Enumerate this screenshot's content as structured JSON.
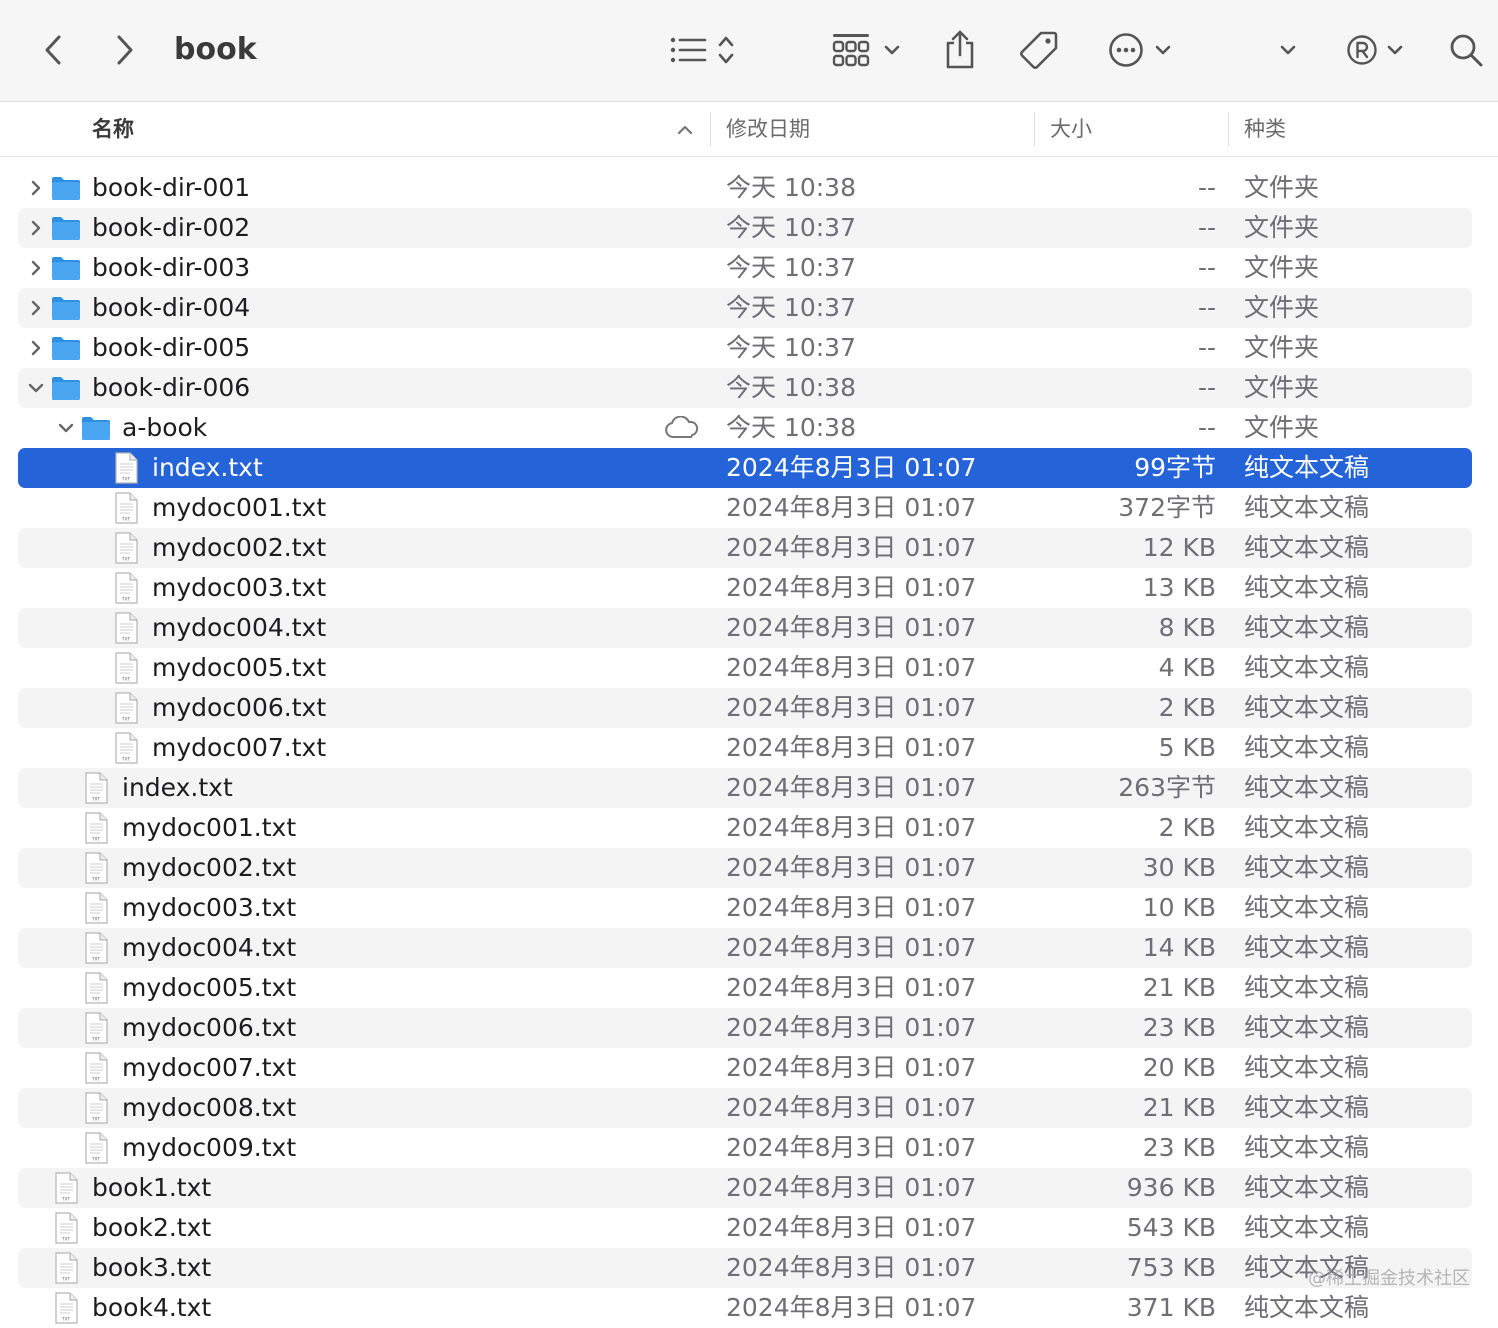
{
  "window": {
    "title": "book"
  },
  "toolbar": {
    "back_icon": "chevron-left-icon",
    "forward_icon": "chevron-right-icon",
    "list_view_icon": "list-icon",
    "sort_icon": "up-down-chevron-icon",
    "group_icon": "grid-icon",
    "share_icon": "share-icon",
    "tag_icon": "tag-icon",
    "more_icon": "ellipsis-circle-icon",
    "registered_icon": "registered-icon",
    "search_icon": "search-icon"
  },
  "columns": {
    "name": "名称",
    "date": "修改日期",
    "size": "大小",
    "kind": "种类"
  },
  "colors": {
    "selection": "#2563d9",
    "folder": "#4ba6f2"
  },
  "rows": [
    {
      "name": "book-dir-001",
      "date": "今天 10:38",
      "size": "--",
      "kind": "文件夹",
      "type": "folder",
      "level": 0,
      "disclosure": "collapsed"
    },
    {
      "name": "book-dir-002",
      "date": "今天 10:37",
      "size": "--",
      "kind": "文件夹",
      "type": "folder",
      "level": 0,
      "disclosure": "collapsed"
    },
    {
      "name": "book-dir-003",
      "date": "今天 10:37",
      "size": "--",
      "kind": "文件夹",
      "type": "folder",
      "level": 0,
      "disclosure": "collapsed"
    },
    {
      "name": "book-dir-004",
      "date": "今天 10:37",
      "size": "--",
      "kind": "文件夹",
      "type": "folder",
      "level": 0,
      "disclosure": "collapsed"
    },
    {
      "name": "book-dir-005",
      "date": "今天 10:37",
      "size": "--",
      "kind": "文件夹",
      "type": "folder",
      "level": 0,
      "disclosure": "collapsed"
    },
    {
      "name": "book-dir-006",
      "date": "今天 10:38",
      "size": "--",
      "kind": "文件夹",
      "type": "folder",
      "level": 0,
      "disclosure": "expanded"
    },
    {
      "name": "a-book",
      "date": "今天 10:38",
      "size": "--",
      "kind": "文件夹",
      "type": "folder",
      "level": 1,
      "disclosure": "expanded",
      "cloud": true
    },
    {
      "name": "index.txt",
      "date": "2024年8月3日 01:07",
      "size": "99字节",
      "kind": "纯文本文稿",
      "type": "txt",
      "level": 2,
      "selected": true
    },
    {
      "name": "mydoc001.txt",
      "date": "2024年8月3日 01:07",
      "size": "372字节",
      "kind": "纯文本文稿",
      "type": "txt",
      "level": 2
    },
    {
      "name": "mydoc002.txt",
      "date": "2024年8月3日 01:07",
      "size": "12 KB",
      "kind": "纯文本文稿",
      "type": "txt",
      "level": 2
    },
    {
      "name": "mydoc003.txt",
      "date": "2024年8月3日 01:07",
      "size": "13 KB",
      "kind": "纯文本文稿",
      "type": "txt",
      "level": 2
    },
    {
      "name": "mydoc004.txt",
      "date": "2024年8月3日 01:07",
      "size": "8 KB",
      "kind": "纯文本文稿",
      "type": "txt",
      "level": 2
    },
    {
      "name": "mydoc005.txt",
      "date": "2024年8月3日 01:07",
      "size": "4 KB",
      "kind": "纯文本文稿",
      "type": "txt",
      "level": 2
    },
    {
      "name": "mydoc006.txt",
      "date": "2024年8月3日 01:07",
      "size": "2 KB",
      "kind": "纯文本文稿",
      "type": "txt",
      "level": 2
    },
    {
      "name": "mydoc007.txt",
      "date": "2024年8月3日 01:07",
      "size": "5 KB",
      "kind": "纯文本文稿",
      "type": "txt",
      "level": 2
    },
    {
      "name": "index.txt",
      "date": "2024年8月3日 01:07",
      "size": "263字节",
      "kind": "纯文本文稿",
      "type": "txt",
      "level": 1
    },
    {
      "name": "mydoc001.txt",
      "date": "2024年8月3日 01:07",
      "size": "2 KB",
      "kind": "纯文本文稿",
      "type": "txt",
      "level": 1
    },
    {
      "name": "mydoc002.txt",
      "date": "2024年8月3日 01:07",
      "size": "30 KB",
      "kind": "纯文本文稿",
      "type": "txt",
      "level": 1
    },
    {
      "name": "mydoc003.txt",
      "date": "2024年8月3日 01:07",
      "size": "10 KB",
      "kind": "纯文本文稿",
      "type": "txt",
      "level": 1
    },
    {
      "name": "mydoc004.txt",
      "date": "2024年8月3日 01:07",
      "size": "14 KB",
      "kind": "纯文本文稿",
      "type": "txt",
      "level": 1
    },
    {
      "name": "mydoc005.txt",
      "date": "2024年8月3日 01:07",
      "size": "21 KB",
      "kind": "纯文本文稿",
      "type": "txt",
      "level": 1
    },
    {
      "name": "mydoc006.txt",
      "date": "2024年8月3日 01:07",
      "size": "23 KB",
      "kind": "纯文本文稿",
      "type": "txt",
      "level": 1
    },
    {
      "name": "mydoc007.txt",
      "date": "2024年8月3日 01:07",
      "size": "20 KB",
      "kind": "纯文本文稿",
      "type": "txt",
      "level": 1
    },
    {
      "name": "mydoc008.txt",
      "date": "2024年8月3日 01:07",
      "size": "21 KB",
      "kind": "纯文本文稿",
      "type": "txt",
      "level": 1
    },
    {
      "name": "mydoc009.txt",
      "date": "2024年8月3日 01:07",
      "size": "23 KB",
      "kind": "纯文本文稿",
      "type": "txt",
      "level": 1
    },
    {
      "name": "book1.txt",
      "date": "2024年8月3日 01:07",
      "size": "936 KB",
      "kind": "纯文本文稿",
      "type": "txt",
      "level": 0
    },
    {
      "name": "book2.txt",
      "date": "2024年8月3日 01:07",
      "size": "543 KB",
      "kind": "纯文本文稿",
      "type": "txt",
      "level": 0
    },
    {
      "name": "book3.txt",
      "date": "2024年8月3日 01:07",
      "size": "753 KB",
      "kind": "纯文本文稿",
      "type": "txt",
      "level": 0
    },
    {
      "name": "book4.txt",
      "date": "2024年8月3日 01:07",
      "size": "371 KB",
      "kind": "纯文本文稿",
      "type": "txt",
      "level": 0
    }
  ],
  "watermark": "@稀土掘金技术社区"
}
